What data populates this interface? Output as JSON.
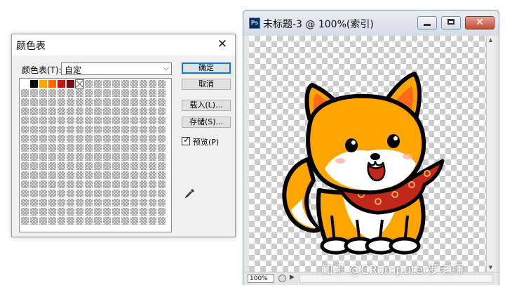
{
  "color_table_dialog": {
    "title": "颜色表",
    "close_icon": "close-icon",
    "table_label": "颜色表(T):",
    "table_select": {
      "value": "自定",
      "icon": "chevron-down-icon"
    },
    "swatches": [
      "#ffffff",
      "#000000",
      "#ffa500",
      "#ff6a00",
      "#b02010",
      "#7a0c0c",
      "transparent"
    ],
    "empty_cell_count": 249,
    "buttons": {
      "ok": "确定",
      "cancel": "取消",
      "load": "载入(L)...",
      "save": "存储(S)..."
    },
    "preview": {
      "label": "预览(P)",
      "checked": true
    },
    "eyedropper_icon": "eyedropper-icon"
  },
  "document_window": {
    "icon": "photoshop-icon",
    "title": "未标题-3 @ 100%(索引)",
    "controls": {
      "minimize": "minimize-icon",
      "maximize": "maximize-icon",
      "close": "close-icon"
    },
    "zoom": "100%",
    "image": "shiba-inu-dog-illustration"
  },
  "watermark": "知乎 @CRomputer罗老师",
  "colors": {
    "accent": "#0078d7",
    "dog_orange": "#ffa500",
    "dog_outline": "#000000",
    "scarf_red": "#c0281a",
    "checker": "#cccccc"
  }
}
